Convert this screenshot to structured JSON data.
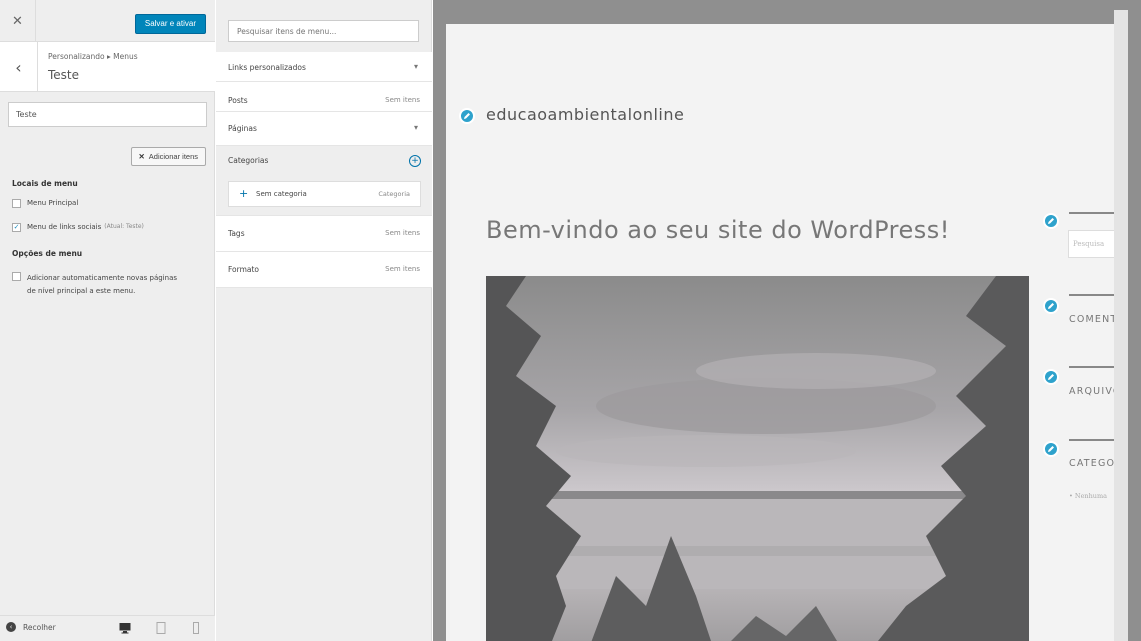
{
  "customizer": {
    "close_label": "✕",
    "save_label": "Salvar e ativar",
    "back_label": "‹",
    "breadcrumb": "Personalizando ▸ Menus",
    "section_title": "Teste",
    "menu_name_value": "Teste",
    "add_items_label": "Adicionar itens",
    "add_items_icon": "✕",
    "locations_heading": "Locais de menu",
    "locations": [
      {
        "label": "Menu Principal",
        "checked": false,
        "note": ""
      },
      {
        "label": "Menu de links sociais",
        "checked": true,
        "note": "(Atual: Teste)"
      }
    ],
    "options_heading": "Opções de menu",
    "auto_add_label_1": "Adicionar automaticamente novas páginas",
    "auto_add_label_2": "de nível principal a este menu.",
    "collapse_label": "Recolher"
  },
  "menu_items_panel": {
    "search_placeholder": "Pesquisar itens de menu...",
    "sections": [
      {
        "title": "Links personalizados",
        "right": "▾"
      },
      {
        "title": "Posts",
        "right": "Sem itens"
      },
      {
        "title": "Páginas",
        "right": "▾"
      },
      {
        "title": "Categorias",
        "right": "+"
      },
      {
        "title": "Tags",
        "right": "Sem itens"
      },
      {
        "title": "Formato",
        "right": "Sem itens"
      }
    ],
    "category_item": {
      "name": "Sem categoria",
      "type": "Categoria"
    }
  },
  "preview": {
    "site_title": "educaoambientalonline",
    "post_title": "Bem-vindo ao seu site do WordPress!",
    "sidebar_search_placeholder": "Pesquisa",
    "widget_titles": [
      "COMENTÁRIOS",
      "ARQUIVOS",
      "CATEGORIAS"
    ],
    "category_bullet": "• Nenhuma"
  },
  "colors": {
    "accent": "#0085ba",
    "link": "#0073aa",
    "edit_shortcut": "#2ea2cc"
  }
}
